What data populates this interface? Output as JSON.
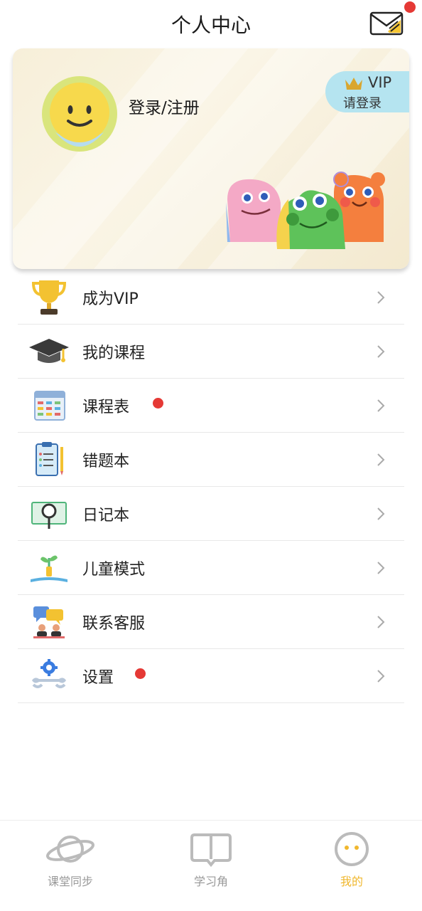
{
  "header": {
    "title": "个人中心"
  },
  "profile": {
    "login_label": "登录/注册",
    "vip_badge": {
      "title": "VIP",
      "subtitle": "请登录"
    }
  },
  "menu": {
    "items": [
      {
        "label": "成为VIP",
        "icon": "trophy-icon",
        "has_dot": false
      },
      {
        "label": "我的课程",
        "icon": "graduation-cap-icon",
        "has_dot": false
      },
      {
        "label": "课程表",
        "icon": "calendar-icon",
        "has_dot": true
      },
      {
        "label": "错题本",
        "icon": "clipboard-icon",
        "has_dot": false
      },
      {
        "label": "日记本",
        "icon": "magnifier-book-icon",
        "has_dot": false
      },
      {
        "label": "儿童模式",
        "icon": "sprout-book-icon",
        "has_dot": false
      },
      {
        "label": "联系客服",
        "icon": "chat-support-icon",
        "has_dot": false
      },
      {
        "label": "设置",
        "icon": "gear-wrench-icon",
        "has_dot": true
      }
    ]
  },
  "tabbar": {
    "tabs": [
      {
        "label": "课堂同步",
        "icon": "planet-icon",
        "active": false
      },
      {
        "label": "学习角",
        "icon": "book-icon",
        "active": false
      },
      {
        "label": "我的",
        "icon": "smiley-icon",
        "active": true
      }
    ]
  },
  "colors": {
    "notification_dot": "#e53935",
    "active_tab": "#f0b72d",
    "vip_badge_bg": "#b5e4f0",
    "card_bg": "#f7efd9"
  }
}
